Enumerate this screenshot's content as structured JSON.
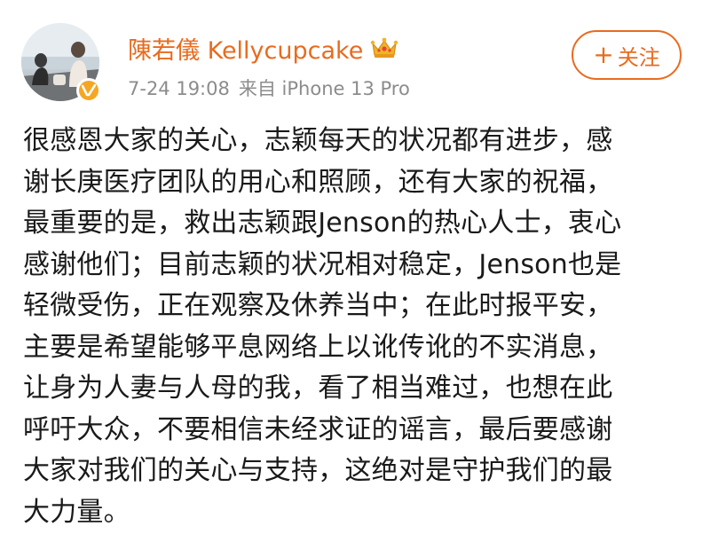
{
  "post": {
    "author": {
      "name": "陳若儀 Kellycupcake",
      "verified_badge_color": "#f5a623",
      "name_color": "#e86b1f"
    },
    "meta": {
      "timestamp": "7-24 19:08",
      "source": "来自 iPhone 13 Pro"
    },
    "follow_button": {
      "plus": "+",
      "label": "关注"
    },
    "text_lines": [
      "很感恩大家的关心，志颖每天的状况都有进步，感",
      "谢长庚医疗团队的用心和照顾，还有大家的祝福，",
      "最重要的是，救出志颖跟Jenson的热心人士，衷心",
      "感谢他们；目前志颖的状况相对稳定，Jenson也是",
      "轻微受伤，正在观察及休养当中；在此时报平安，",
      "主要是希望能够平息网络上以讹传讹的不实消息，",
      "让身为人妻与人母的我，看了相当难过，也想在此",
      "呼吁大众，不要相信未经求证的谣言，最后要感谢",
      "大家对我们的关心与支持，这绝对是守护我们的最",
      "大力量。"
    ]
  },
  "icons": {
    "avatar": "avatar-photo",
    "verified": "verified-v-icon",
    "crown": "crown-icon",
    "plus": "plus-icon"
  }
}
